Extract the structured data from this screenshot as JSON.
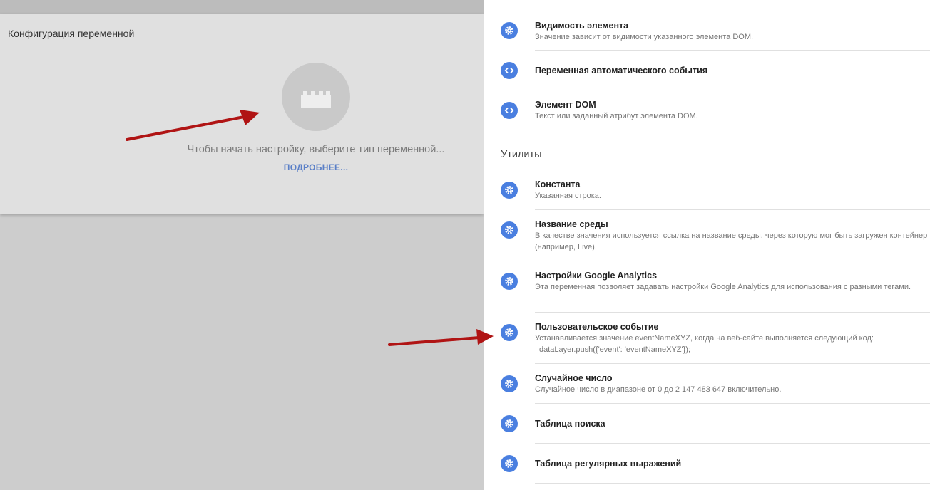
{
  "config": {
    "header_title": "Конфигурация переменной",
    "empty_text": "Чтобы начать настройку, выберите тип переменной...",
    "learn_more": "ПОДРОБНЕЕ..."
  },
  "panel": {
    "section_utilities": "Утилиты",
    "items": [
      {
        "icon": "gear-icon",
        "title": "Видимость элемента",
        "desc": "Значение зависит от видимости указанного элемента DOM."
      },
      {
        "icon": "code-icon",
        "title": "Переменная автоматического события",
        "desc": ""
      },
      {
        "icon": "code-icon",
        "title": "Элемент DOM",
        "desc": "Текст или заданный атрибут элемента DOM."
      },
      {
        "icon": "gear-icon",
        "title": "Константа",
        "desc": "Указанная строка."
      },
      {
        "icon": "gear-icon",
        "title": "Название среды",
        "desc": "В качестве значения используется ссылка на название среды, через которую мог быть загружен контейнер (например, Live)."
      },
      {
        "icon": "gear-icon",
        "title": "Настройки Google Analytics",
        "desc": "Эта переменная позволяет задавать настройки Google Analytics для использования с разными тегами."
      },
      {
        "icon": "gear-icon",
        "title": "Пользовательское событие",
        "desc": "Устанавливается значение eventNameXYZ, когда на веб-сайте выполняется следующий код:",
        "code": "dataLayer.push({'event': 'eventNameXYZ'});"
      },
      {
        "icon": "gear-icon",
        "title": "Случайное число",
        "desc": "Случайное число в диапазоне от 0 до 2 147 483 647 включительно."
      },
      {
        "icon": "gear-icon",
        "title": "Таблица поиска",
        "desc": ""
      },
      {
        "icon": "gear-icon",
        "title": "Таблица регулярных выражений",
        "desc": ""
      }
    ]
  },
  "colors": {
    "accent": "#4a7fe0",
    "arrow": "#b01414",
    "link": "#5a7fc7"
  }
}
